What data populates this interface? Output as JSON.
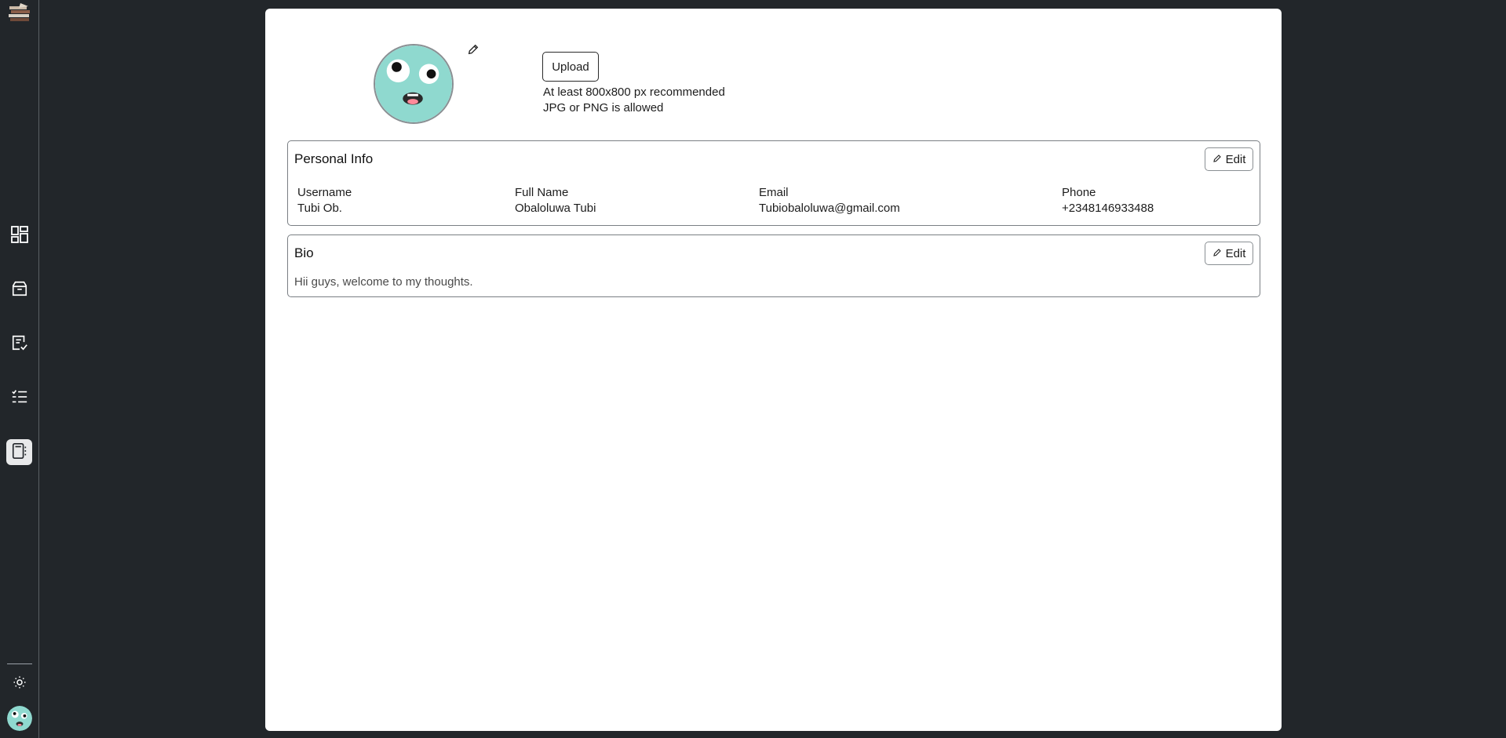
{
  "sidebar": {
    "logo_icon": "book-stack-logo",
    "nav": [
      {
        "name": "dashboard",
        "icon": "dashboard-icon",
        "active": false
      },
      {
        "name": "archive",
        "icon": "archive-icon",
        "active": false
      },
      {
        "name": "drafts",
        "icon": "document-check-icon",
        "active": false
      },
      {
        "name": "tasks",
        "icon": "checklist-icon",
        "active": false
      },
      {
        "name": "notebook",
        "icon": "notebook-icon",
        "active": true
      }
    ],
    "theme_icon": "sun-icon"
  },
  "profile": {
    "avatar_icon": "surprised-face-avatar",
    "edit_avatar_icon": "pencil-icon",
    "upload_label": "Upload",
    "hint_size": "At least 800x800 px recommended",
    "hint_format": "JPG or PNG is allowed"
  },
  "personal_info": {
    "title": "Personal Info",
    "edit_label": "Edit",
    "fields": [
      {
        "label": "Username",
        "value": "Tubi Ob."
      },
      {
        "label": "Full Name",
        "value": "Obaloluwa Tubi"
      },
      {
        "label": "Email",
        "value": "Tubiobaloluwa@gmail.com"
      },
      {
        "label": "Phone",
        "value": "+2348146933488"
      }
    ]
  },
  "bio": {
    "title": "Bio",
    "edit_label": "Edit",
    "text": "Hii guys, welcome to my thoughts."
  },
  "colors": {
    "background": "#22262a",
    "card": "#ffffff",
    "avatar": "#8fd9cf"
  }
}
